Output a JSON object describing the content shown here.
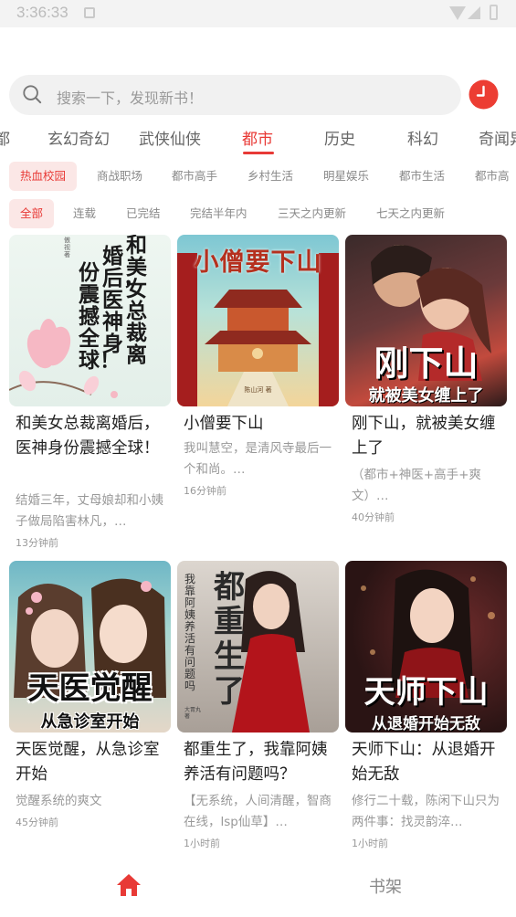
{
  "status": {
    "time": "3:36:33"
  },
  "search": {
    "placeholder": "搜索一下，发现新书！"
  },
  "categories": [
    "都",
    "玄幻奇幻",
    "武侠仙侠",
    "都市",
    "历史",
    "科幻",
    "奇闻异"
  ],
  "active_category": "都市",
  "tags": [
    "热血校园",
    "商战职场",
    "都市高手",
    "乡村生活",
    "明星娱乐",
    "都市生活",
    "都市高"
  ],
  "statuses": [
    "全部",
    "连载",
    "已完结",
    "完结半年内",
    "三天之内更新",
    "七天之内更新"
  ],
  "books": [
    {
      "title": "和美女总裁离婚后，医神身份震撼全球！",
      "desc": "结婚三年，丈母娘却和小姨子做局陷害林凡，…",
      "time": "13分钟前",
      "cover_text": "和美女总裁离婚后，医神身份震撼全球！",
      "cover_author": "傲视 著"
    },
    {
      "title": "小僧要下山",
      "desc": "我叫慧空，是清风寺最后一个和尚。…",
      "time": "16分钟前",
      "cover_text": "小僧要下山",
      "cover_author": "陈山河 著"
    },
    {
      "title": "刚下山，就被美女缠上了",
      "desc": "（都市+神医+高手+爽文）…",
      "time": "40分钟前",
      "cover_text": "刚下山",
      "cover_sub": "就被美女缠上了"
    },
    {
      "title": "天医觉醒，从急诊室开始",
      "desc": "觉醒系统的爽文",
      "time": "45分钟前",
      "cover_text": "天医觉醒",
      "cover_sub": "从急诊室开始"
    },
    {
      "title": "都重生了，我靠阿姨养活有问题吗？",
      "desc": "【无系统，人间清醒，智商在线，lsp仙草】…",
      "time": "1小时前",
      "cover_text": "都重生了",
      "cover_side": "我靠阿姨养活有问题吗",
      "cover_author": "大胃丸 著"
    },
    {
      "title": "天师下山：从退婚开始无敌",
      "desc": "修行二十载，陈闲下山只为两件事：找灵韵淬…",
      "time": "1小时前",
      "cover_text": "天师下山",
      "cover_sub": "从退婚开始无敌"
    }
  ],
  "nav": {
    "shelf_label": "书架"
  },
  "colors": {
    "accent": "#e83a36",
    "search_bg": "#f1f1f1",
    "tag_bg": "#fbe7e6"
  }
}
